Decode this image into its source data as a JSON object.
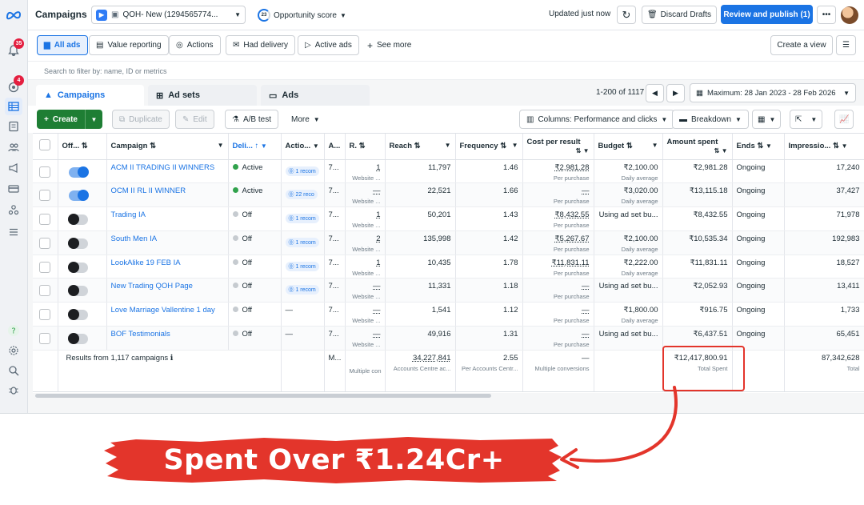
{
  "topbar": {
    "title": "Campaigns",
    "account": "QOH- New (1294565774...",
    "opportunity_value": "23",
    "opportunity_label": "Opportunity score",
    "updated": "Updated just now",
    "discard_label": "Discard Drafts",
    "review_label": "Review and publish (1)"
  },
  "rail": {
    "notif_badge": "35",
    "msg_badge": "4"
  },
  "filters": {
    "all_ads": "All ads",
    "value_reporting": "Value reporting",
    "actions": "Actions",
    "had_delivery": "Had delivery",
    "active_ads": "Active ads",
    "see_more": "See more",
    "create_view": "Create a view"
  },
  "search": {
    "placeholder": "Search to filter by: name, ID or metrics"
  },
  "tabs": {
    "campaigns": "Campaigns",
    "ad_sets": "Ad sets",
    "ads": "Ads"
  },
  "pager": {
    "range": "1-200 of 1117",
    "date": "Maximum: 28 Jan 2023 - 28 Feb 2026"
  },
  "toolbar": {
    "create": "Create",
    "duplicate": "Duplicate",
    "edit": "Edit",
    "ab_test": "A/B test",
    "more": "More",
    "columns": "Columns: Performance and clicks",
    "breakdown": "Breakdown"
  },
  "columns": {
    "off": "Off...",
    "campaign": "Campaign",
    "delivery": "Deli...",
    "actions": "Actio...",
    "attr": "A...",
    "results": "R.",
    "reach": "Reach",
    "frequency": "Frequency",
    "cpr": "Cost per result",
    "budget": "Budget",
    "amount": "Amount spent",
    "ends": "Ends",
    "impressions": "Impressio..."
  },
  "rows": [
    {
      "name": "ACM II TRADING II WINNERS",
      "on": true,
      "delivery": "Active",
      "status": "act",
      "actions": "1 recom",
      "attr": "7...",
      "result": "1",
      "result_sub": "Website ...",
      "reach": "11,797",
      "freq": "1.46",
      "cpr": "₹2,981.28",
      "cpr_sub": "Per purchase",
      "budget": "₹2,100.00",
      "budget_sub": "Daily average",
      "spent": "₹2,981.28",
      "ends": "Ongoing",
      "impr": "17,240"
    },
    {
      "name": "OCM II RL II WINNER",
      "on": true,
      "delivery": "Active",
      "status": "act",
      "actions": "22 reco",
      "attr": "7...",
      "result": "—",
      "result_sub": "Website ...",
      "reach": "22,521",
      "freq": "1.66",
      "cpr": "—",
      "cpr_sub": "Per purchase",
      "budget": "₹3,020.00",
      "budget_sub": "Daily average",
      "spent": "₹13,115.18",
      "ends": "Ongoing",
      "impr": "37,427"
    },
    {
      "name": "Trading IA",
      "on": false,
      "delivery": "Off",
      "status": "off",
      "actions": "1 recom",
      "attr": "7...",
      "result": "1",
      "result_sub": "Website ...",
      "reach": "50,201",
      "freq": "1.43",
      "cpr": "₹8,432.55",
      "cpr_sub": "Per purchase",
      "budget": "Using ad set bu...",
      "budget_sub": "",
      "spent": "₹8,432.55",
      "ends": "Ongoing",
      "impr": "71,978"
    },
    {
      "name": "South Men IA",
      "on": false,
      "delivery": "Off",
      "status": "off",
      "actions": "1 recom",
      "attr": "7...",
      "result": "2",
      "result_sub": "Website ...",
      "reach": "135,998",
      "freq": "1.42",
      "cpr": "₹5,267.67",
      "cpr_sub": "Per purchase",
      "budget": "₹2,100.00",
      "budget_sub": "Daily average",
      "spent": "₹10,535.34",
      "ends": "Ongoing",
      "impr": "192,983"
    },
    {
      "name": "LookAlike 19 FEB IA",
      "on": false,
      "delivery": "Off",
      "status": "off",
      "actions": "1 recom",
      "attr": "7...",
      "result": "1",
      "result_sub": "Website ...",
      "reach": "10,435",
      "freq": "1.78",
      "cpr": "₹11,831.11",
      "cpr_sub": "Per purchase",
      "budget": "₹2,222.00",
      "budget_sub": "Daily average",
      "spent": "₹11,831.11",
      "ends": "Ongoing",
      "impr": "18,527"
    },
    {
      "name": "New Trading QOH Page",
      "on": false,
      "delivery": "Off",
      "status": "off",
      "actions": "1 recom",
      "attr": "7...",
      "result": "—",
      "result_sub": "Website ...",
      "reach": "11,331",
      "freq": "1.18",
      "cpr": "—",
      "cpr_sub": "Per purchase",
      "budget": "Using ad set bu...",
      "budget_sub": "",
      "spent": "₹2,052.93",
      "ends": "Ongoing",
      "impr": "13,411"
    },
    {
      "name": "Love Marriage Vallentine 1 day",
      "on": false,
      "delivery": "Off",
      "status": "off",
      "actions": "—",
      "attr": "7...",
      "result": "—",
      "result_sub": "Website ...",
      "reach": "1,541",
      "freq": "1.12",
      "cpr": "—",
      "cpr_sub": "Per purchase",
      "budget": "₹1,800.00",
      "budget_sub": "Daily average",
      "spent": "₹916.75",
      "ends": "Ongoing",
      "impr": "1,733"
    },
    {
      "name": "BOF Testimonials",
      "on": false,
      "delivery": "Off",
      "status": "off",
      "actions": "—",
      "attr": "7...",
      "result": "—",
      "result_sub": "Website ...",
      "reach": "49,916",
      "freq": "1.31",
      "cpr": "—",
      "cpr_sub": "Per purchase",
      "budget": "Using ad set bu...",
      "budget_sub": "",
      "spent": "₹6,437.51",
      "ends": "Ongoing",
      "impr": "65,451"
    }
  ],
  "totals": {
    "label": "Results from 1,117 campaigns",
    "attr": "M...",
    "result_sub": "Multiple con",
    "reach": "34,227,841",
    "reach_sub": "Accounts Centre ac...",
    "freq": "2.55",
    "freq_sub": "Per Accounts Centr...",
    "cpr": "—",
    "cpr_sub": "Multiple conversions",
    "spent": "₹12,417,800.91",
    "spent_sub": "Total Spent",
    "impr": "87,342,628",
    "impr_sub": "Total"
  },
  "banner": {
    "text": "Spent Over ₹1.24Cr+",
    "color": "#e3352b"
  },
  "colors": {
    "accent": "#1b74e4",
    "create": "#1e7e34",
    "active": "#31a24c",
    "highlight": "#e3352b"
  }
}
